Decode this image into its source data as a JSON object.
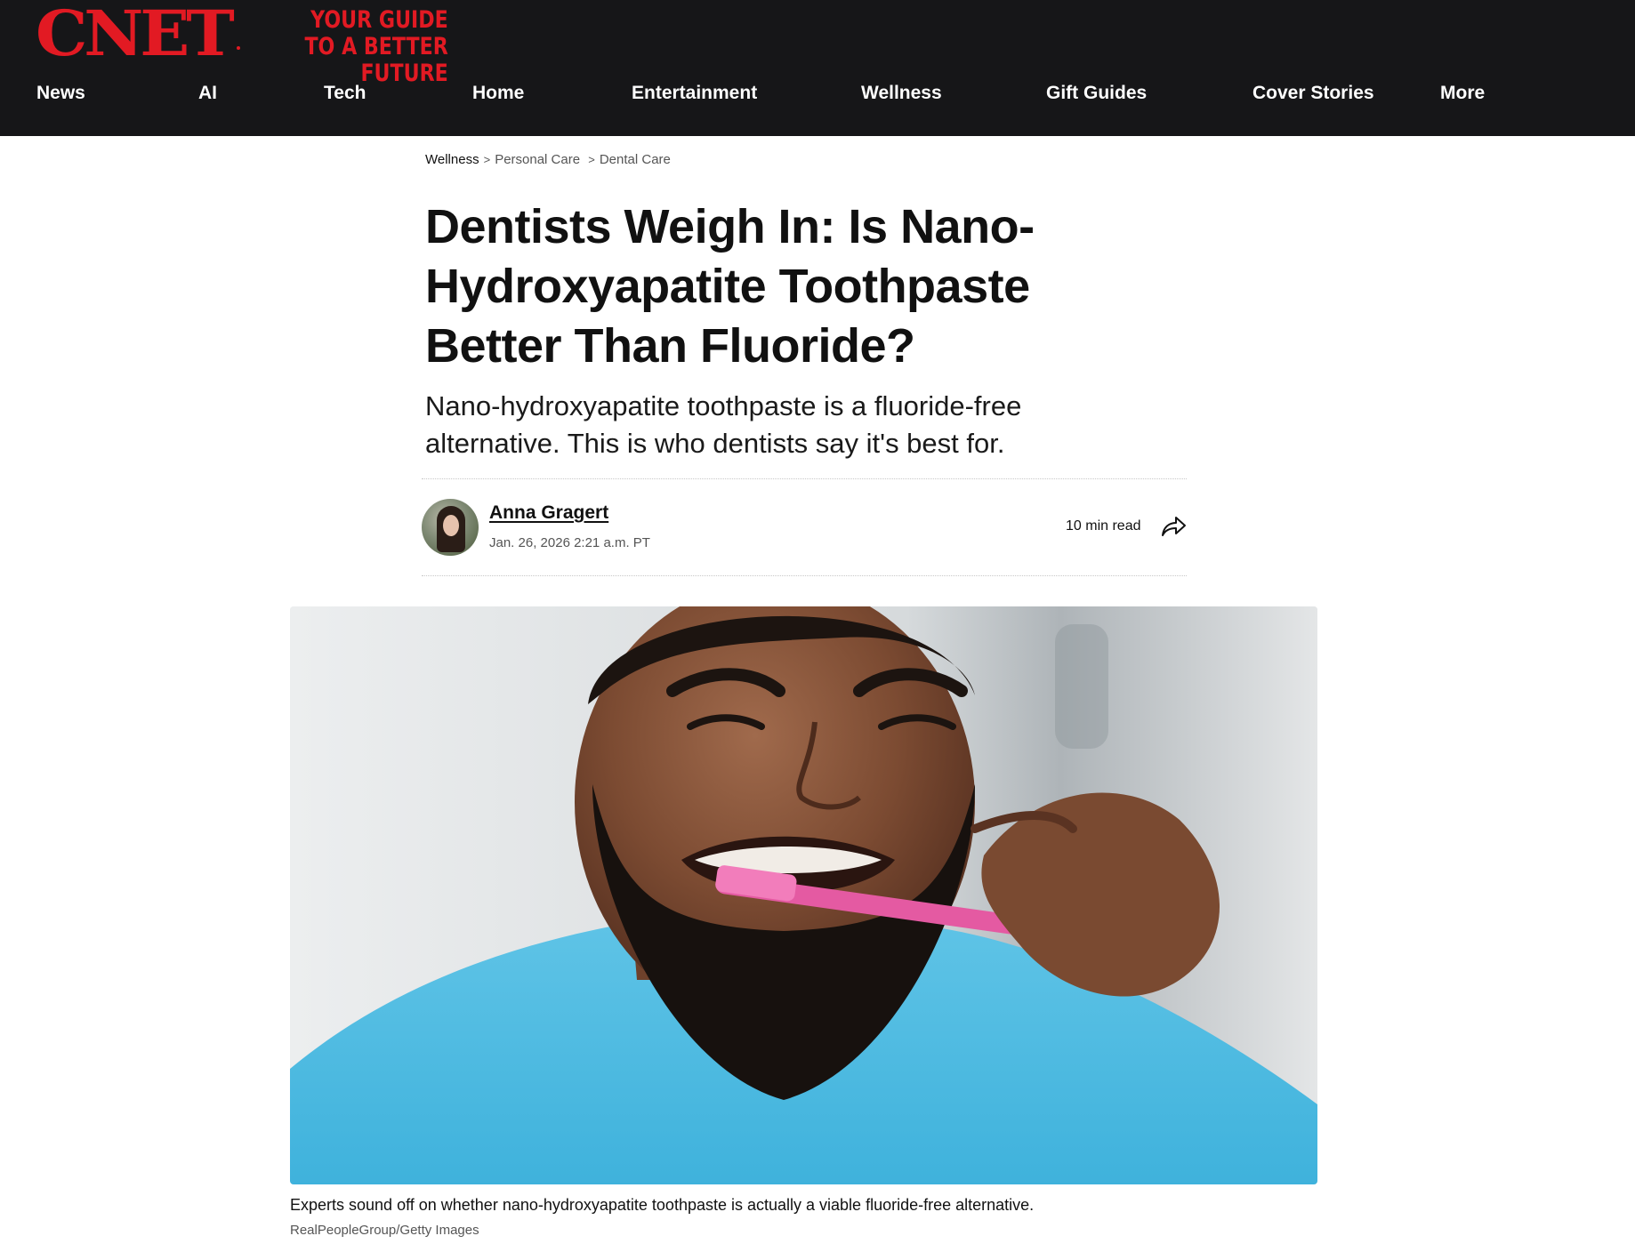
{
  "brand": {
    "logo": "CNET",
    "tagline_line1": "YOUR GUIDE",
    "tagline_line2": "TO A BETTER FUTURE",
    "accent_color": "#e21a23",
    "header_bg": "#161618"
  },
  "nav": {
    "items": [
      {
        "label": "News"
      },
      {
        "label": "AI"
      },
      {
        "label": "Tech"
      },
      {
        "label": "Home"
      },
      {
        "label": "Entertainment"
      },
      {
        "label": "Wellness"
      },
      {
        "label": "Gift Guides"
      },
      {
        "label": "Cover Stories"
      },
      {
        "label": "More"
      }
    ]
  },
  "breadcrumb": {
    "items": [
      {
        "label": "Wellness"
      },
      {
        "label": "Personal Care"
      },
      {
        "label": "Dental Care"
      }
    ],
    "separator": ">"
  },
  "article": {
    "title_lines": [
      "Dentists Weigh In: Is Nano-",
      "Hydroxyapatite Toothpaste",
      "Better Than Fluoride?"
    ],
    "subtitle_lines": [
      "Nano-hydroxyapatite toothpaste is a fluoride-free",
      "alternative. This is who dentists say it's best for."
    ],
    "author": "Anna Gragert",
    "date": "Jan. 26, 2026 2:21 a.m. PT",
    "read_time": "10 min read",
    "share_icon": "share-arrow-icon",
    "image_caption": "Experts sound off on whether nano-hydroxyapatite toothpaste is actually a viable fluoride-free alternative.",
    "image_credit": "RealPeopleGroup/Getty Images"
  }
}
